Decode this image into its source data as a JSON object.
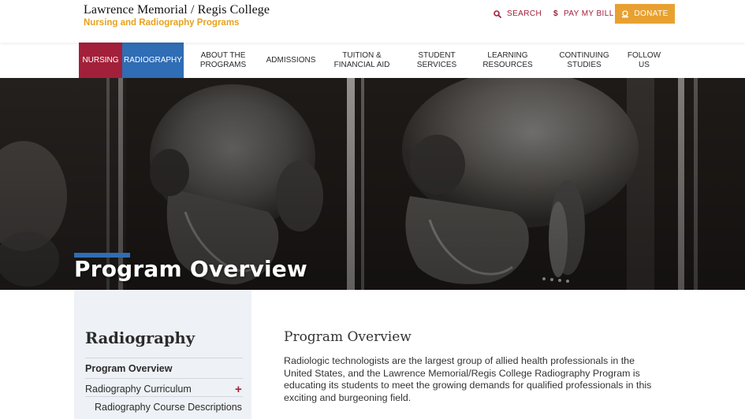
{
  "header": {
    "logo_line1": "Lawrence Memorial / Regis College",
    "logo_line2": "Nursing and Radiography Programs",
    "search_label": "SEARCH",
    "search_icon": "search-icon",
    "bill_label": "PAY MY BILL",
    "bill_icon": "dollar-icon",
    "donate_label": "DONATE",
    "donate_icon": "donate-icon"
  },
  "nav": {
    "items": [
      {
        "line1": "NURSING",
        "line2": ""
      },
      {
        "line1": "RADIOGRAPHY",
        "line2": ""
      },
      {
        "line1": "ABOUT THE",
        "line2": "PROGRAMS"
      },
      {
        "line1": "ADMISSIONS",
        "line2": ""
      },
      {
        "line1": "TUITION &",
        "line2": "FINANCIAL AID"
      },
      {
        "line1": "STUDENT",
        "line2": "SERVICES"
      },
      {
        "line1": "LEARNING",
        "line2": "RESOURCES"
      },
      {
        "line1": "CONTINUING",
        "line2": "STUDIES"
      },
      {
        "line1": "FOLLOW",
        "line2": "US"
      }
    ]
  },
  "hero": {
    "title": "Program Overview"
  },
  "sidebar": {
    "title": "Radiography",
    "items": [
      {
        "label": "Program Overview"
      },
      {
        "label": "Radiography Curriculum"
      },
      {
        "label": "Radiography Course Descriptions"
      }
    ],
    "expand_symbol": "+"
  },
  "content": {
    "title": "Program Overview",
    "body": "Radiologic technologists are the largest group of allied health professionals in the United States, and the Lawrence Memorial/Regis College Radiography Program is educating its students to meet the growing demands for qualified professionals in this exciting and burgeoning field."
  },
  "colors": {
    "nursing": "#a3203a",
    "radiography": "#2f6db5",
    "donate": "#e8a131",
    "logo_accent": "#e8a11d"
  }
}
